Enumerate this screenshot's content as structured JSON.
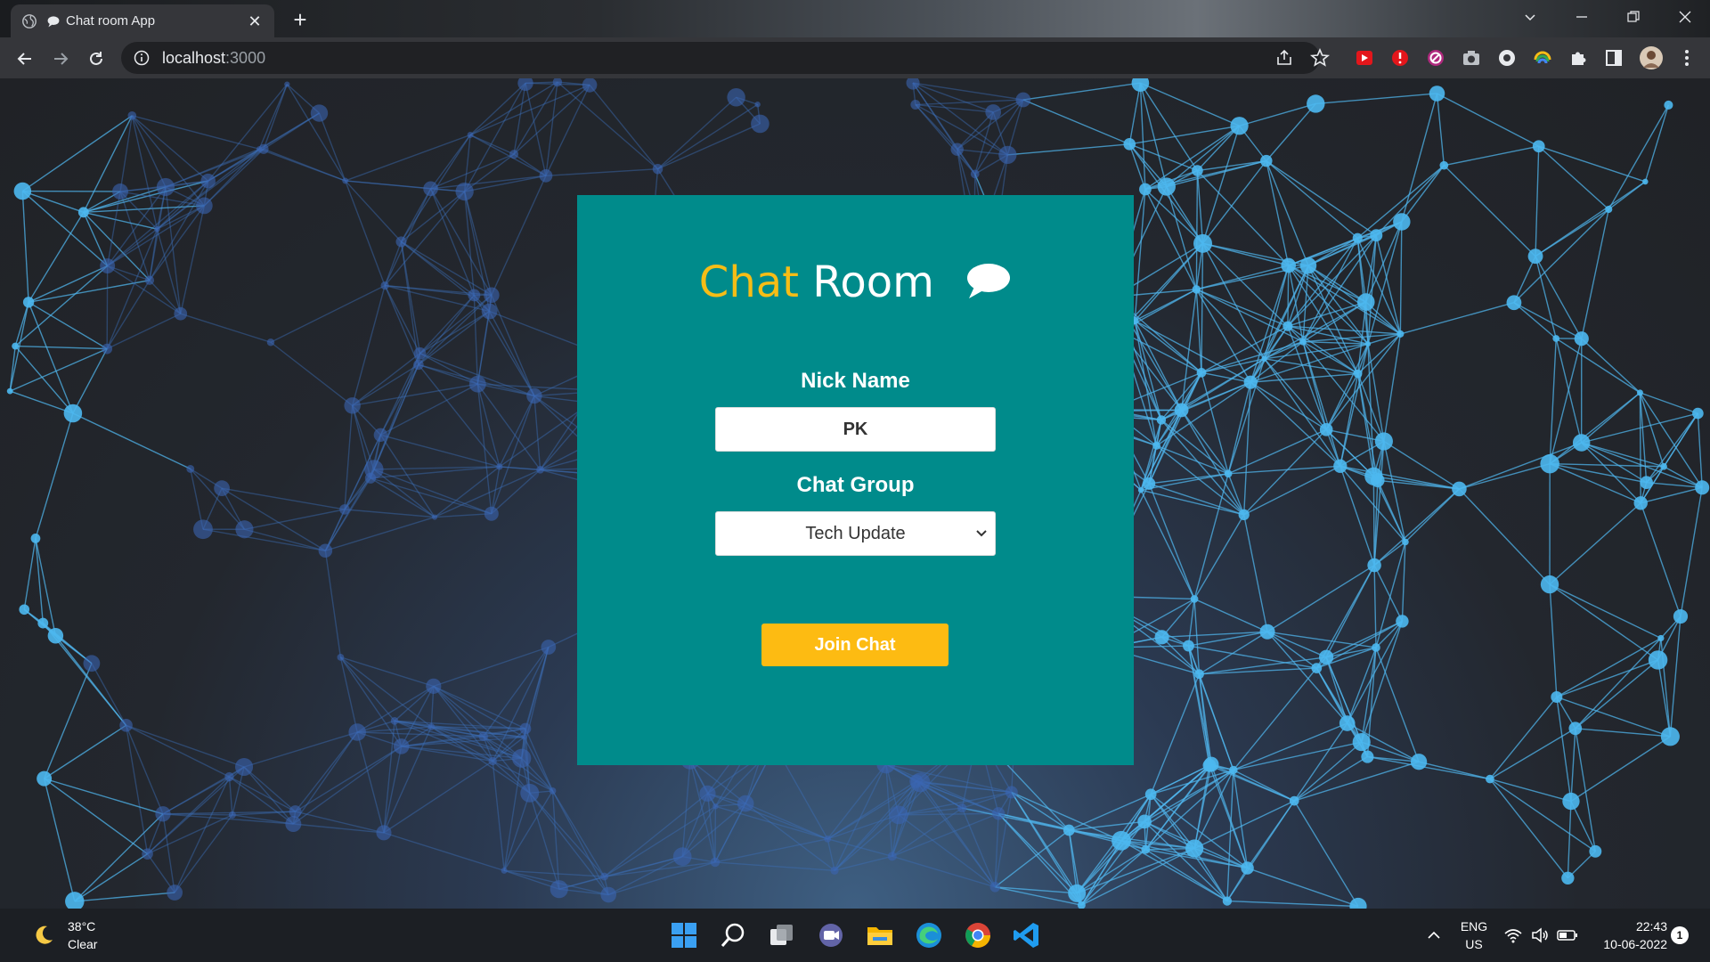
{
  "browser": {
    "tab_title": "Chat room App",
    "tab_close": "✕",
    "new_tab": "+",
    "url_host": "localhost",
    "url_port": ":3000"
  },
  "page": {
    "heading_word1": "Chat",
    "heading_word2": "Room",
    "nickname_label": "Nick Name",
    "nickname_value": "PK",
    "group_label": "Chat Group",
    "group_selected": "Tech Update",
    "join_button": "Join Chat"
  },
  "colors": {
    "card_bg": "#008b8b",
    "accent_yellow": "#f6bd16",
    "button_yellow": "#fdbb12"
  },
  "taskbar": {
    "temperature": "38°C",
    "condition": "Clear",
    "lang": "ENG",
    "region": "US",
    "time": "22:43",
    "date": "10-06-2022",
    "notification_count": "1"
  }
}
